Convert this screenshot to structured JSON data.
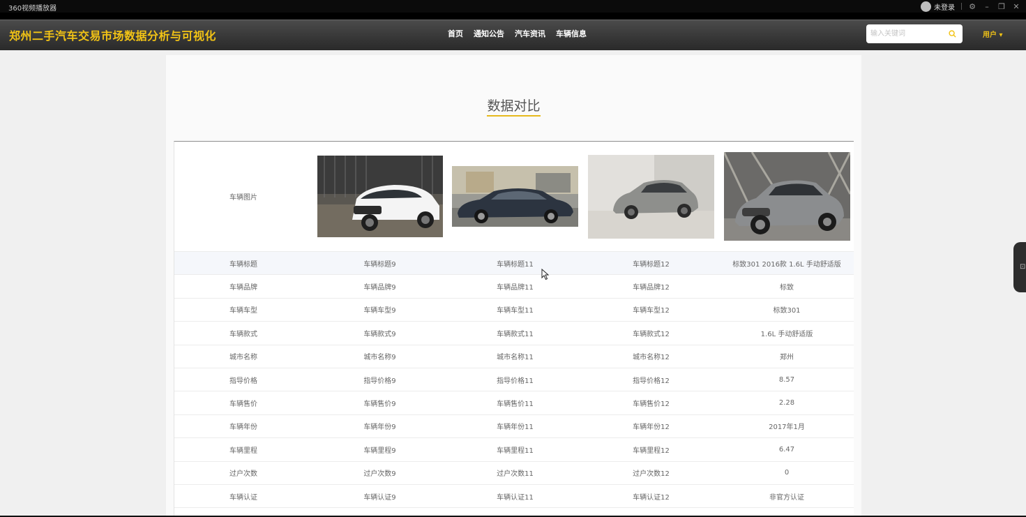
{
  "player": {
    "title": "360视频播放器",
    "login": "未登录"
  },
  "navbar": {
    "site_title": "郑州二手汽车交易市场数据分析与可视化",
    "menu": [
      "首页",
      "通知公告",
      "汽车资讯",
      "车辆信息"
    ],
    "search_placeholder": "输入关键词",
    "user_label": "用户 ▾"
  },
  "colors": {
    "accent": "#f2c315",
    "navbar": "#3a3a3a",
    "underline": "#e6b91c"
  },
  "compare": {
    "title": "数据对比",
    "photo_label": "车辆图片",
    "cars": [
      {
        "image": "white-kia-suv"
      },
      {
        "image": "dark-gray-sedan"
      },
      {
        "image": "silver-crossover-showroom"
      },
      {
        "image": "gray-infiniti-crossover"
      }
    ],
    "rows": [
      [
        "车辆标题",
        "车辆标题9",
        "车辆标题11",
        "车辆标题12",
        "标致301 2016款 1.6L 手动舒适版"
      ],
      [
        "车辆品牌",
        "车辆品牌9",
        "车辆品牌11",
        "车辆品牌12",
        "标致"
      ],
      [
        "车辆车型",
        "车辆车型9",
        "车辆车型11",
        "车辆车型12",
        "标致301"
      ],
      [
        "车辆款式",
        "车辆款式9",
        "车辆款式11",
        "车辆款式12",
        "1.6L 手动舒适版"
      ],
      [
        "城市名称",
        "城市名称9",
        "城市名称11",
        "城市名称12",
        "郑州"
      ],
      [
        "指导价格",
        "指导价格9",
        "指导价格11",
        "指导价格12",
        "8.57"
      ],
      [
        "车辆售价",
        "车辆售价9",
        "车辆售价11",
        "车辆售价12",
        "2.28"
      ],
      [
        "车辆年份",
        "车辆年份9",
        "车辆年份11",
        "车辆年份12",
        "2017年1月"
      ],
      [
        "车辆里程",
        "车辆里程9",
        "车辆里程11",
        "车辆里程12",
        "6.47"
      ],
      [
        "过户次数",
        "过户次数9",
        "过户次数11",
        "过户次数12",
        "0"
      ],
      [
        "车辆认证",
        "车辆认证9",
        "车辆认证11",
        "车辆认证12",
        "非官方认证"
      ]
    ]
  }
}
